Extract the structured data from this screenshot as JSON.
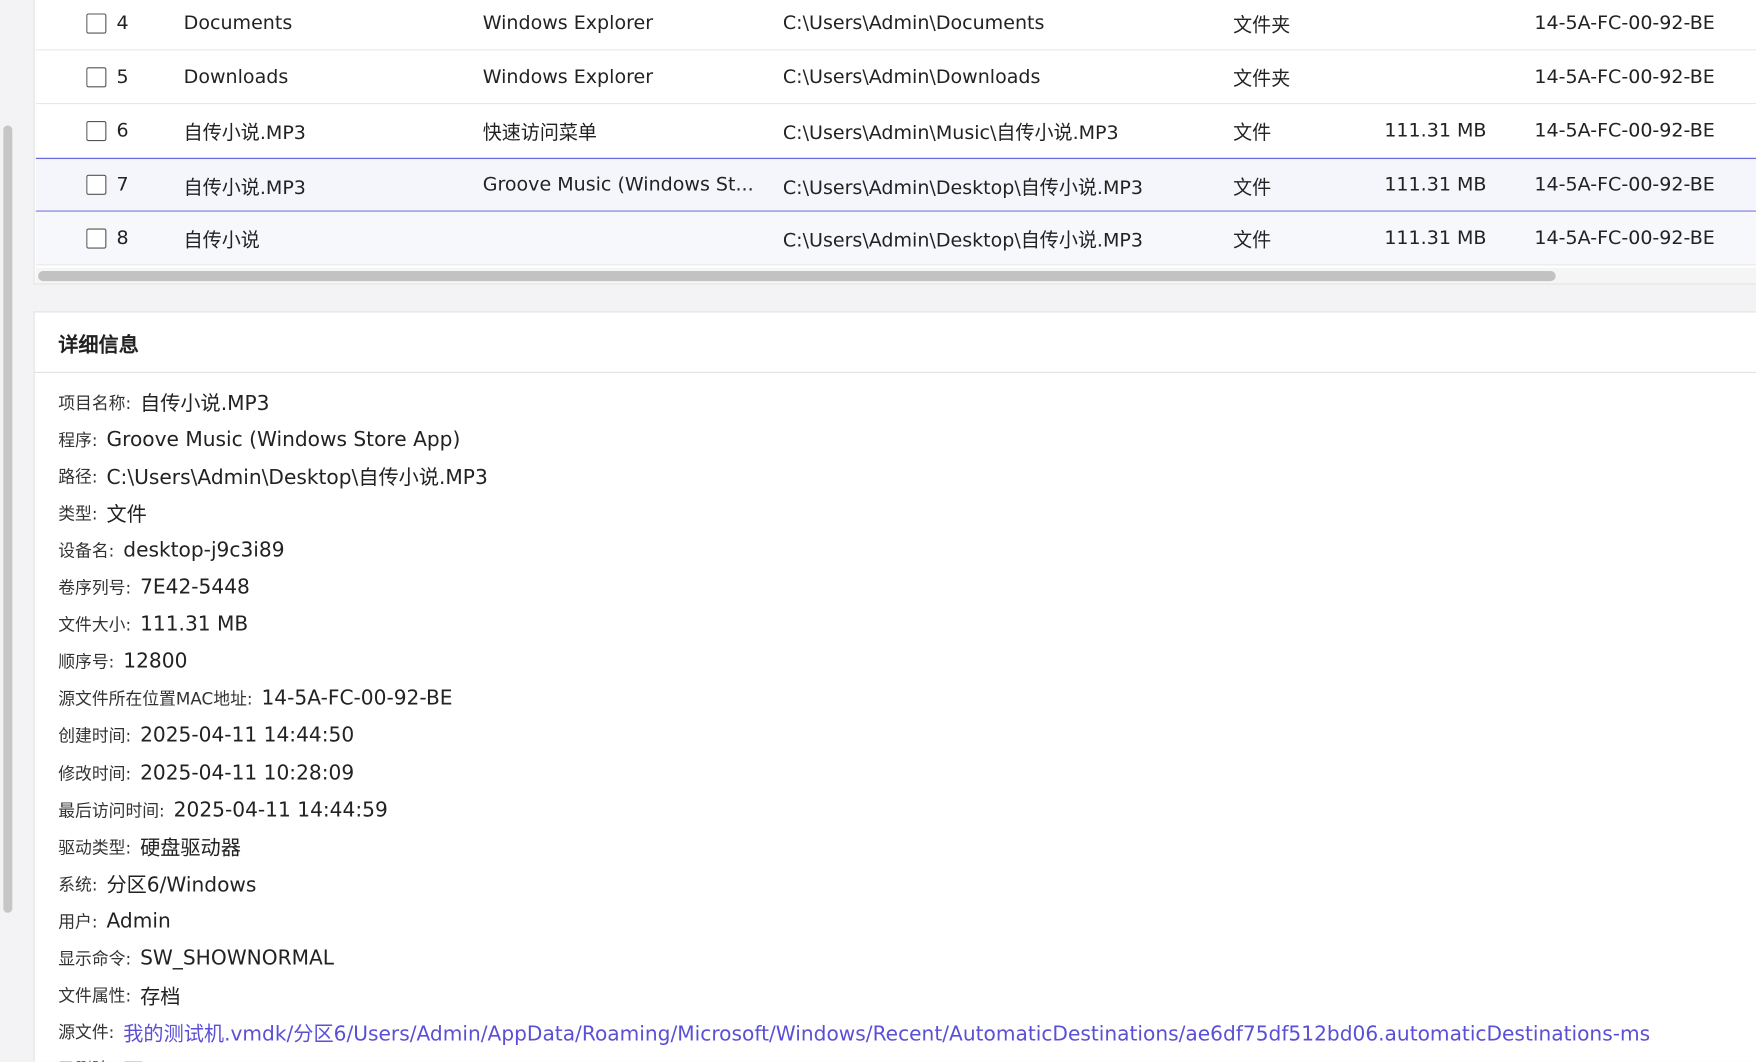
{
  "table": {
    "rows": [
      {
        "index": "4",
        "name": "Documents",
        "program": "Windows Explorer",
        "path": "C:\\Users\\Admin\\Documents",
        "type": "文件夹",
        "size": "",
        "mac": "14-5A-FC-00-92-BE",
        "state": "normal"
      },
      {
        "index": "5",
        "name": "Downloads",
        "program": "Windows Explorer",
        "path": "C:\\Users\\Admin\\Downloads",
        "type": "文件夹",
        "size": "",
        "mac": "14-5A-FC-00-92-BE",
        "state": "normal"
      },
      {
        "index": "6",
        "name": "自传小说.MP3",
        "program": "快速访问菜单",
        "path": "C:\\Users\\Admin\\Music\\自传小说.MP3",
        "type": "文件",
        "size": "111.31 MB",
        "mac": "14-5A-FC-00-92-BE",
        "state": "normal"
      },
      {
        "index": "7",
        "name": "自传小说.MP3",
        "program": "Groove Music (Windows St...",
        "path": "C:\\Users\\Admin\\Desktop\\自传小说.MP3",
        "type": "文件",
        "size": "111.31 MB",
        "mac": "14-5A-FC-00-92-BE",
        "state": "selected"
      },
      {
        "index": "8",
        "name": "自传小说",
        "program": "",
        "path": "C:\\Users\\Admin\\Desktop\\自传小说.MP3",
        "type": "文件",
        "size": "111.31 MB",
        "mac": "14-5A-FC-00-92-BE",
        "state": "highlight"
      }
    ]
  },
  "details": {
    "title": "详细信息",
    "fields": [
      {
        "label": "项目名称:",
        "value": "自传小说.MP3"
      },
      {
        "label": "程序:",
        "value": "Groove Music (Windows Store App)"
      },
      {
        "label": "路径:",
        "value": "C:\\Users\\Admin\\Desktop\\自传小说.MP3"
      },
      {
        "label": "类型:",
        "value": "文件"
      },
      {
        "label": "设备名:",
        "value": "desktop-j9c3i89"
      },
      {
        "label": "卷序列号:",
        "value": "7E42-5448"
      },
      {
        "label": "文件大小:",
        "value": "111.31 MB"
      },
      {
        "label": "顺序号:",
        "value": "12800"
      },
      {
        "label": "源文件所在位置MAC地址:",
        "value": "14-5A-FC-00-92-BE"
      },
      {
        "label": "创建时间:",
        "value": "2025-04-11 14:44:50"
      },
      {
        "label": "修改时间:",
        "value": "2025-04-11 10:28:09"
      },
      {
        "label": "最后访问时间:",
        "value": "2025-04-11 14:44:59"
      },
      {
        "label": "驱动类型:",
        "value": "硬盘驱动器"
      },
      {
        "label": "系统:",
        "value": "分区6/Windows"
      },
      {
        "label": "用户:",
        "value": "Admin"
      },
      {
        "label": "显示命令:",
        "value": "SW_SHOWNORMAL"
      },
      {
        "label": "文件属性:",
        "value": "存档"
      },
      {
        "label": "源文件:",
        "value": "我的测试机.vmdk/分区6/Users/Admin/AppData/Roaming/Microsoft/Windows/Recent/AutomaticDestinations/ae6df75df512bd06.automaticDestinations-ms",
        "link": true
      },
      {
        "label": "已删除:",
        "value": "否"
      }
    ]
  },
  "colors": {
    "selection_border": "#6a6ae0",
    "link": "#5b4fd6"
  }
}
